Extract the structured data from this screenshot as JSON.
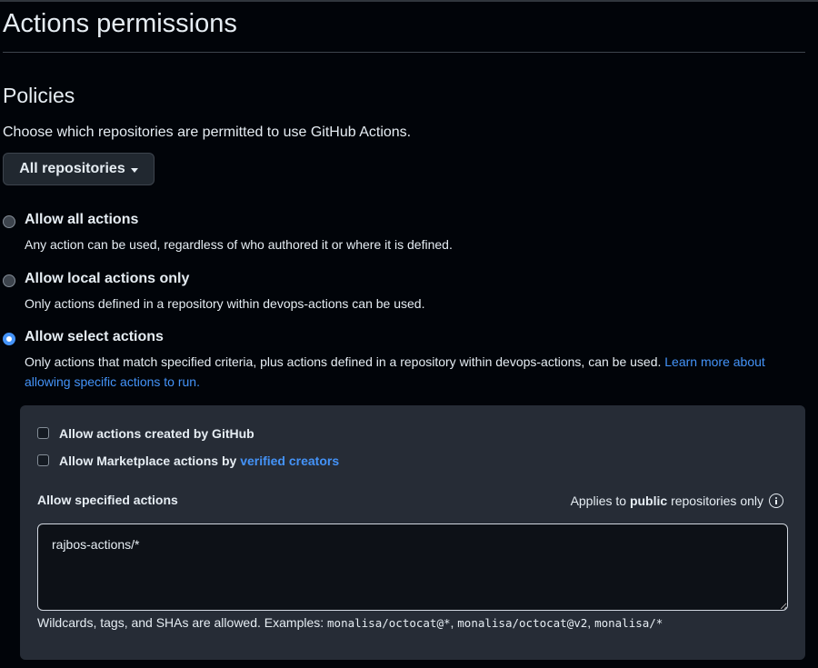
{
  "page": {
    "title": "Actions permissions",
    "section_title": "Policies",
    "section_desc": "Choose which repositories are permitted to use GitHub Actions."
  },
  "repo_dropdown": {
    "selected": "All repositories"
  },
  "policies": [
    {
      "label": "Allow all actions",
      "help": "Any action can be used, regardless of who authored it or where it is defined.",
      "checked": false
    },
    {
      "label": "Allow local actions only",
      "help": "Only actions defined in a repository within devops-actions can be used.",
      "checked": false
    },
    {
      "label": "Allow select actions",
      "help": "Only actions that match specified criteria, plus actions defined in a repository within devops-actions, can be used.",
      "link": "Learn more about allowing specific actions to run.",
      "checked": true
    }
  ],
  "select_panel": {
    "cb_github": "Allow actions created by GitHub",
    "cb_marketplace_prefix": "Allow Marketplace actions by",
    "cb_marketplace_link": "verified creators",
    "specified_label": "Allow specified actions",
    "applies_prefix": "Applies to",
    "applies_bold": "public",
    "applies_suffix": "repositories only",
    "textarea_value": "rajbos-actions/*",
    "hint_prefix": "Wildcards, tags, and SHAs are allowed. Examples:",
    "ex1": "monalisa/octocat@*",
    "ex2": "monalisa/octocat@v2",
    "ex3": "monalisa/*"
  },
  "colors": {
    "background": "#010409",
    "panel": "#262c36",
    "accent": "#4493f8",
    "text": "#e6edf3"
  },
  "icons": {
    "dropdown": "chevron-down-icon",
    "info": "info-icon"
  }
}
